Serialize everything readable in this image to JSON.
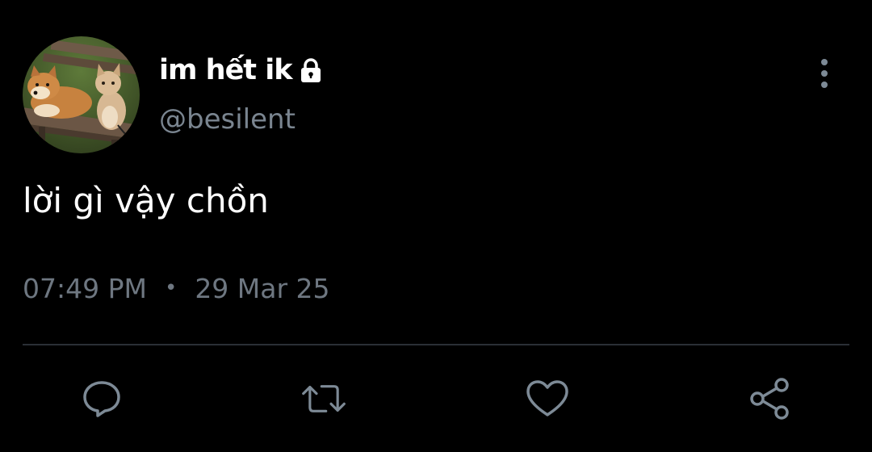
{
  "tweet": {
    "display_name": "im hết ik",
    "handle": "@besilent",
    "text": "lời gì vậy chồn",
    "time": "07:49 PM",
    "separator": "•",
    "date": "29 Mar 25",
    "protected": true
  },
  "icons": {
    "lock": "lock-icon",
    "more": "more-vertical-icon",
    "reply": "reply-icon",
    "retweet": "retweet-icon",
    "like": "heart-icon",
    "share": "share-icon"
  },
  "colors": {
    "background": "#000000",
    "text_primary": "#ffffff",
    "text_secondary": "#6e7781",
    "icon": "#7d8a96",
    "divider": "#2a2f35"
  }
}
